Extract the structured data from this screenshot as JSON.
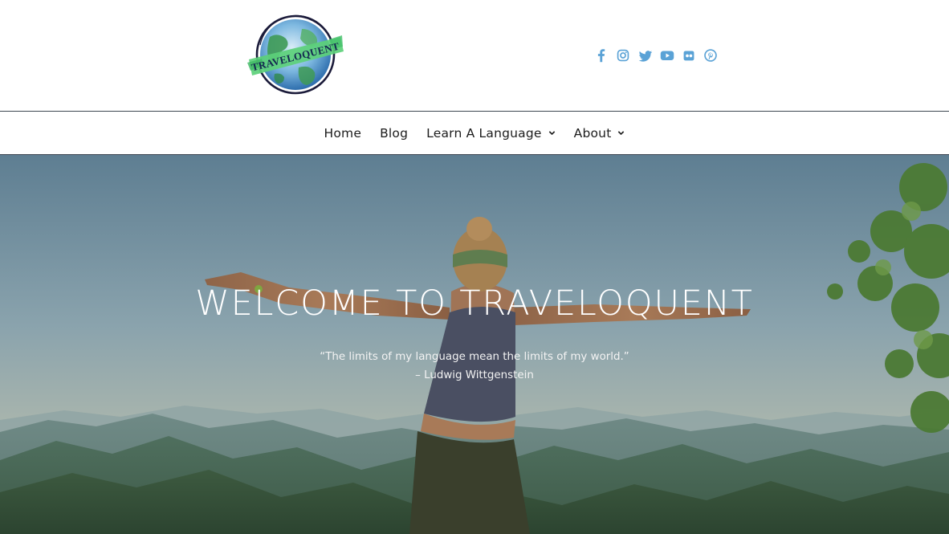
{
  "header": {
    "logo_text": "TRAVELOQUENT",
    "social": [
      {
        "icon": "facebook-icon"
      },
      {
        "icon": "instagram-icon"
      },
      {
        "icon": "twitter-icon"
      },
      {
        "icon": "youtube-icon"
      },
      {
        "icon": "flickr-icon"
      },
      {
        "icon": "pinterest-icon"
      }
    ],
    "social_color": "#5aa2d6"
  },
  "nav": {
    "items": [
      {
        "label": "Home"
      },
      {
        "label": "Blog"
      },
      {
        "label": "Learn A Language"
      },
      {
        "label": "About"
      }
    ]
  },
  "hero": {
    "title": "WELCOME TO TRAVELOQUENT",
    "quote": "“The limits of my language mean the limits of my world.”",
    "author": "– Ludwig Wittgenstein"
  }
}
